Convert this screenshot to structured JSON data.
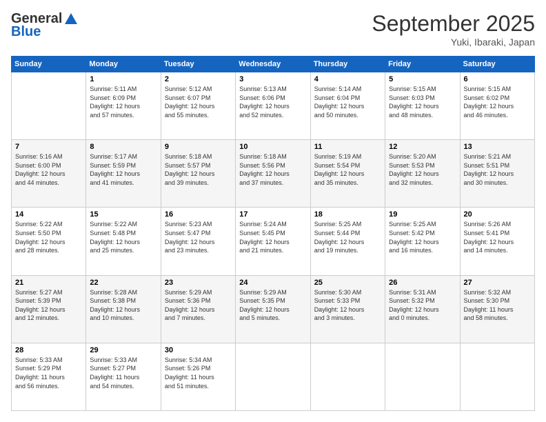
{
  "header": {
    "logo_general": "General",
    "logo_blue": "Blue",
    "month_title": "September 2025",
    "location": "Yuki, Ibaraki, Japan"
  },
  "weekdays": [
    "Sunday",
    "Monday",
    "Tuesday",
    "Wednesday",
    "Thursday",
    "Friday",
    "Saturday"
  ],
  "weeks": [
    [
      {
        "day": "",
        "info": ""
      },
      {
        "day": "1",
        "info": "Sunrise: 5:11 AM\nSunset: 6:09 PM\nDaylight: 12 hours\nand 57 minutes."
      },
      {
        "day": "2",
        "info": "Sunrise: 5:12 AM\nSunset: 6:07 PM\nDaylight: 12 hours\nand 55 minutes."
      },
      {
        "day": "3",
        "info": "Sunrise: 5:13 AM\nSunset: 6:06 PM\nDaylight: 12 hours\nand 52 minutes."
      },
      {
        "day": "4",
        "info": "Sunrise: 5:14 AM\nSunset: 6:04 PM\nDaylight: 12 hours\nand 50 minutes."
      },
      {
        "day": "5",
        "info": "Sunrise: 5:15 AM\nSunset: 6:03 PM\nDaylight: 12 hours\nand 48 minutes."
      },
      {
        "day": "6",
        "info": "Sunrise: 5:15 AM\nSunset: 6:02 PM\nDaylight: 12 hours\nand 46 minutes."
      }
    ],
    [
      {
        "day": "7",
        "info": "Sunrise: 5:16 AM\nSunset: 6:00 PM\nDaylight: 12 hours\nand 44 minutes."
      },
      {
        "day": "8",
        "info": "Sunrise: 5:17 AM\nSunset: 5:59 PM\nDaylight: 12 hours\nand 41 minutes."
      },
      {
        "day": "9",
        "info": "Sunrise: 5:18 AM\nSunset: 5:57 PM\nDaylight: 12 hours\nand 39 minutes."
      },
      {
        "day": "10",
        "info": "Sunrise: 5:18 AM\nSunset: 5:56 PM\nDaylight: 12 hours\nand 37 minutes."
      },
      {
        "day": "11",
        "info": "Sunrise: 5:19 AM\nSunset: 5:54 PM\nDaylight: 12 hours\nand 35 minutes."
      },
      {
        "day": "12",
        "info": "Sunrise: 5:20 AM\nSunset: 5:53 PM\nDaylight: 12 hours\nand 32 minutes."
      },
      {
        "day": "13",
        "info": "Sunrise: 5:21 AM\nSunset: 5:51 PM\nDaylight: 12 hours\nand 30 minutes."
      }
    ],
    [
      {
        "day": "14",
        "info": "Sunrise: 5:22 AM\nSunset: 5:50 PM\nDaylight: 12 hours\nand 28 minutes."
      },
      {
        "day": "15",
        "info": "Sunrise: 5:22 AM\nSunset: 5:48 PM\nDaylight: 12 hours\nand 25 minutes."
      },
      {
        "day": "16",
        "info": "Sunrise: 5:23 AM\nSunset: 5:47 PM\nDaylight: 12 hours\nand 23 minutes."
      },
      {
        "day": "17",
        "info": "Sunrise: 5:24 AM\nSunset: 5:45 PM\nDaylight: 12 hours\nand 21 minutes."
      },
      {
        "day": "18",
        "info": "Sunrise: 5:25 AM\nSunset: 5:44 PM\nDaylight: 12 hours\nand 19 minutes."
      },
      {
        "day": "19",
        "info": "Sunrise: 5:25 AM\nSunset: 5:42 PM\nDaylight: 12 hours\nand 16 minutes."
      },
      {
        "day": "20",
        "info": "Sunrise: 5:26 AM\nSunset: 5:41 PM\nDaylight: 12 hours\nand 14 minutes."
      }
    ],
    [
      {
        "day": "21",
        "info": "Sunrise: 5:27 AM\nSunset: 5:39 PM\nDaylight: 12 hours\nand 12 minutes."
      },
      {
        "day": "22",
        "info": "Sunrise: 5:28 AM\nSunset: 5:38 PM\nDaylight: 12 hours\nand 10 minutes."
      },
      {
        "day": "23",
        "info": "Sunrise: 5:29 AM\nSunset: 5:36 PM\nDaylight: 12 hours\nand 7 minutes."
      },
      {
        "day": "24",
        "info": "Sunrise: 5:29 AM\nSunset: 5:35 PM\nDaylight: 12 hours\nand 5 minutes."
      },
      {
        "day": "25",
        "info": "Sunrise: 5:30 AM\nSunset: 5:33 PM\nDaylight: 12 hours\nand 3 minutes."
      },
      {
        "day": "26",
        "info": "Sunrise: 5:31 AM\nSunset: 5:32 PM\nDaylight: 12 hours\nand 0 minutes."
      },
      {
        "day": "27",
        "info": "Sunrise: 5:32 AM\nSunset: 5:30 PM\nDaylight: 11 hours\nand 58 minutes."
      }
    ],
    [
      {
        "day": "28",
        "info": "Sunrise: 5:33 AM\nSunset: 5:29 PM\nDaylight: 11 hours\nand 56 minutes."
      },
      {
        "day": "29",
        "info": "Sunrise: 5:33 AM\nSunset: 5:27 PM\nDaylight: 11 hours\nand 54 minutes."
      },
      {
        "day": "30",
        "info": "Sunrise: 5:34 AM\nSunset: 5:26 PM\nDaylight: 11 hours\nand 51 minutes."
      },
      {
        "day": "",
        "info": ""
      },
      {
        "day": "",
        "info": ""
      },
      {
        "day": "",
        "info": ""
      },
      {
        "day": "",
        "info": ""
      }
    ]
  ]
}
